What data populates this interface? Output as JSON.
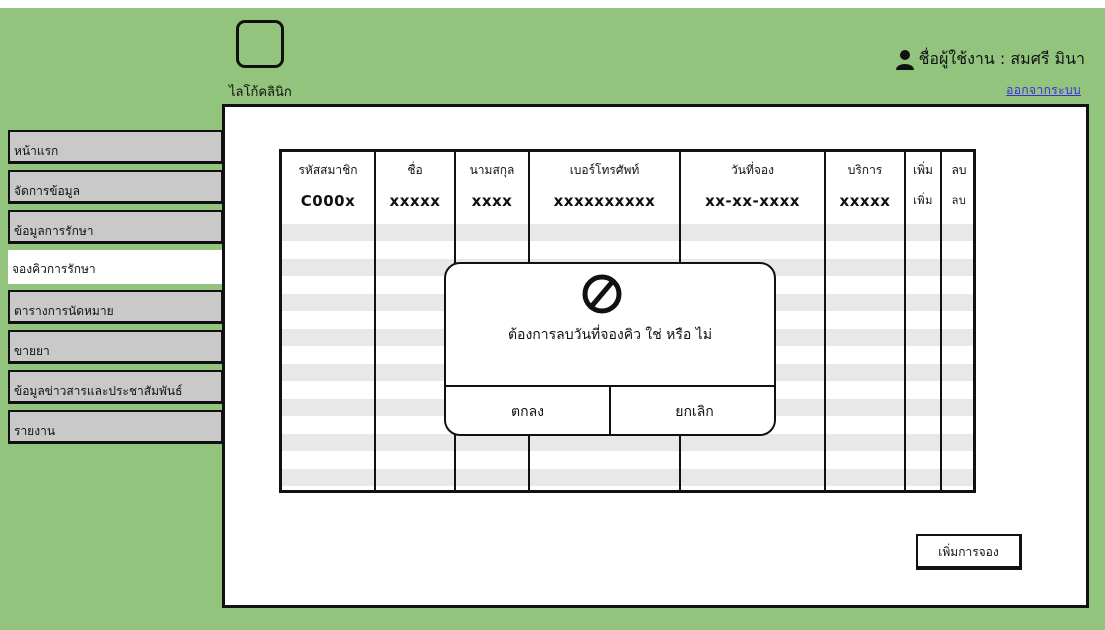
{
  "header": {
    "clinic_name": "ไลโก้คลินิก",
    "user_label": "ชื่อผู้ใช้งาน : สมศรี  มินา",
    "logout_label": "ออกจากระบบ"
  },
  "sidebar": {
    "items": [
      {
        "label": "หน้าแรก",
        "active": false
      },
      {
        "label": "จัดการข้อมูล",
        "active": false
      },
      {
        "label": "ข้อมูลการรักษา",
        "active": false
      },
      {
        "label": "จองคิวการรักษา",
        "active": true
      },
      {
        "label": "ตารางการนัดหมาย",
        "active": false
      },
      {
        "label": "ขายยา",
        "active": false
      },
      {
        "label": "ข้อมูลข่าวสารและประชาสัมพันธ์",
        "active": false
      },
      {
        "label": "รายงาน",
        "active": false
      }
    ]
  },
  "table": {
    "columns": [
      "รหัสสมาชิก",
      "ชื่อ",
      "นามสกุล",
      "เบอร์โทรศัพท์",
      "วันที่จอง",
      "บริการ",
      "เพิ่ม",
      "ลบ"
    ],
    "rows": [
      [
        "C000x",
        "xxxxx",
        "xxxx",
        "xxxxxxxxxx",
        "xx-xx-xxxx",
        "xxxxx",
        "เพิ่ม",
        "ลบ"
      ]
    ]
  },
  "dialog": {
    "icon": "prohibited-icon",
    "message": "ต้องการลบวันที่จองคิว ใช่ หรือ ไม่",
    "ok_label": "ตกลง",
    "cancel_label": "ยกเลิก"
  },
  "actions": {
    "add_booking_label": "เพิ่มการจอง"
  }
}
